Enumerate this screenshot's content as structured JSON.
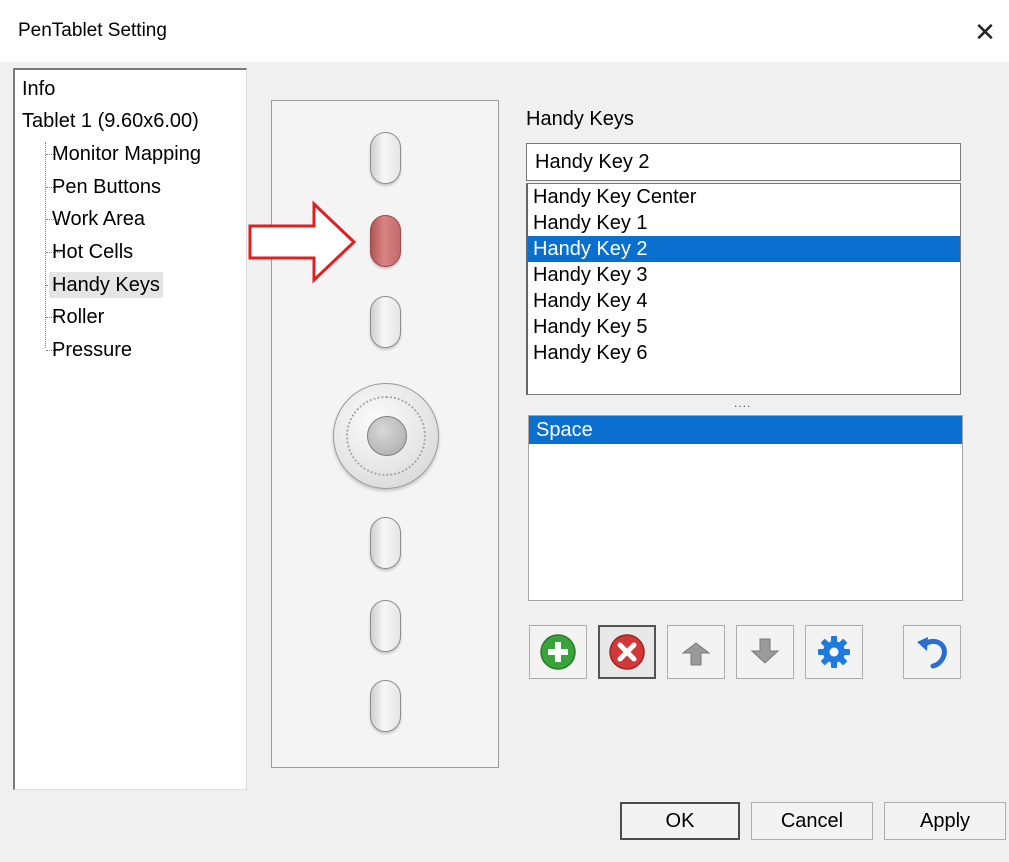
{
  "window": {
    "title": "PenTablet Setting",
    "close_glyph": "✕"
  },
  "tree": {
    "root_items": [
      "Info",
      "Tablet  1 (9.60x6.00)"
    ],
    "children": [
      "Monitor Mapping",
      "Pen Buttons",
      "Work Area",
      "Hot Cells",
      "Handy Keys",
      "Roller",
      "Pressure"
    ],
    "selected": "Handy Keys"
  },
  "device": {
    "selected_key": "Handy Key 2",
    "highlight_color": "#d98484",
    "arrow_color": "#e02020",
    "icon": "tablet-handy-keys-illustration"
  },
  "handy_keys": {
    "title": "Handy Keys",
    "current_value": "Handy Key 2",
    "items": [
      "Handy Key Center",
      "Handy Key 1",
      "Handy Key 2",
      "Handy Key 3",
      "Handy Key 4",
      "Handy Key 5",
      "Handy Key 6"
    ],
    "selected_index": 2,
    "splitter": "...."
  },
  "actions": {
    "items": [
      "Space"
    ],
    "selected_index": 0
  },
  "toolbar": {
    "add_icon": "plus-circle-icon",
    "delete_icon": "delete-x-icon",
    "move_up_icon": "move-up-icon",
    "move_down_icon": "move-down-icon",
    "settings_icon": "gear-icon",
    "undo_icon": "undo-icon"
  },
  "footer": {
    "ok_label": "OK",
    "cancel_label": "Cancel",
    "apply_label": "Apply"
  },
  "colors": {
    "selection_blue": "#0a6fce",
    "add_green": "#3aa23a",
    "delete_red": "#d23838",
    "gear_blue": "#1f7ae0"
  }
}
